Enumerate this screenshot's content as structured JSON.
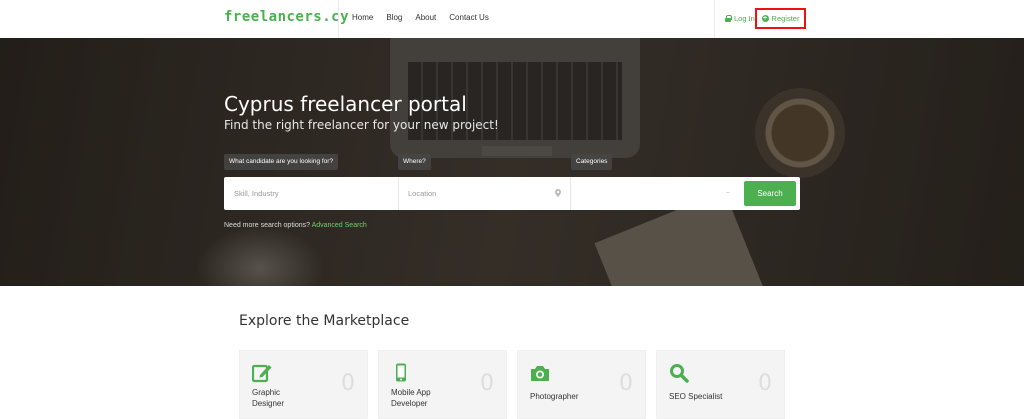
{
  "header": {
    "logo": "freelancers.cy",
    "nav": [
      "Home",
      "Blog",
      "About",
      "Contact Us"
    ],
    "login_label": "Log In",
    "register_label": "Register",
    "accent": "#4caf50"
  },
  "hero": {
    "title": "Cyprus freelancer portal",
    "subtitle": "Find the right freelancer for your new project!",
    "labels": {
      "candidate": "What candidate are you looking for?",
      "where": "Where?",
      "categories": "Categories"
    },
    "search": {
      "skill_placeholder": "Skill, Industry",
      "location_placeholder": "Location",
      "category_value": "",
      "button": "Search"
    },
    "advanced_prefix": "Need more search options?",
    "advanced_link": "Advanced Search"
  },
  "marketplace": {
    "title": "Explore the Marketplace",
    "cards": [
      {
        "label_line1": "Graphic",
        "label_line2": "Designer",
        "count": "0",
        "icon": "edit-icon"
      },
      {
        "label_line1": "Mobile App",
        "label_line2": "Developer",
        "count": "0",
        "icon": "mobile-icon"
      },
      {
        "label_line1": "Photographer",
        "label_line2": "",
        "count": "0",
        "icon": "camera-icon"
      },
      {
        "label_line1": "SEO Specialist",
        "label_line2": "",
        "count": "0",
        "icon": "search-icon"
      }
    ]
  }
}
